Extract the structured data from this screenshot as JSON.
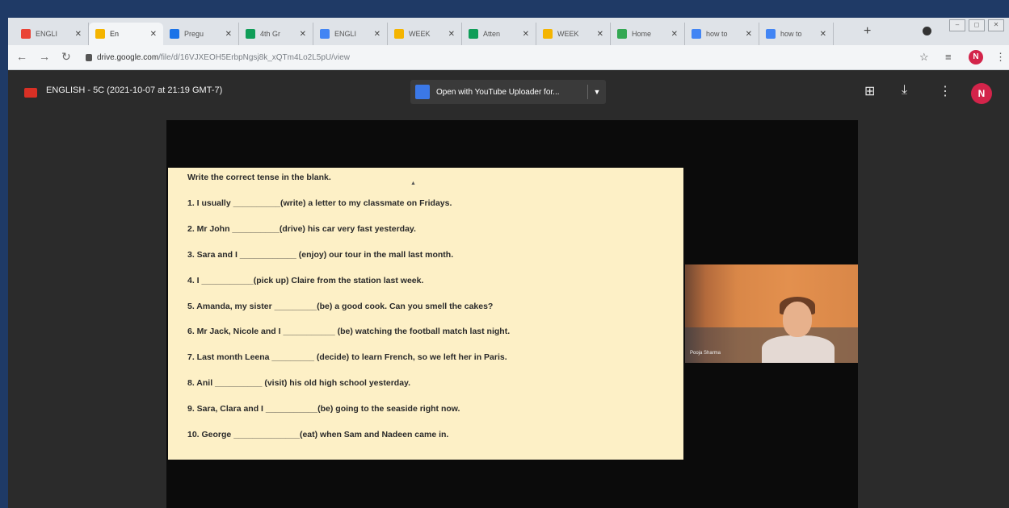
{
  "browser": {
    "tabs": [
      {
        "label": "ENGLI",
        "favicon": "gmail-icon",
        "color": "#ea4335",
        "active": false
      },
      {
        "label": "En",
        "favicon": "drive-icon",
        "color": "#f4b400",
        "active": true
      },
      {
        "label": "Pregu",
        "favicon": "forms-icon",
        "color": "#1a73e8",
        "active": false
      },
      {
        "label": "4th Gr",
        "favicon": "drive-icon",
        "color": "#0f9d58",
        "active": false
      },
      {
        "label": "ENGLI",
        "favicon": "docs-icon",
        "color": "#4285f4",
        "active": false
      },
      {
        "label": "WEEK",
        "favicon": "slides-icon",
        "color": "#f4b400",
        "active": false
      },
      {
        "label": "Atten",
        "favicon": "sheets-icon",
        "color": "#0f9d58",
        "active": false
      },
      {
        "label": "WEEK",
        "favicon": "slides-icon",
        "color": "#f4b400",
        "active": false
      },
      {
        "label": "Home",
        "favicon": "classroom-icon",
        "color": "#34a853",
        "active": false
      },
      {
        "label": "how to",
        "favicon": "google-icon",
        "color": "#4285f4",
        "active": false
      },
      {
        "label": "how to",
        "favicon": "google-icon",
        "color": "#4285f4",
        "active": false
      }
    ],
    "address": {
      "host": "drive.google.com",
      "path": "/file/d/16VJXEOH5ErbpNgsj8k_xQTm4Lo2L5pU/view"
    },
    "profile_initial": "N"
  },
  "viewer": {
    "file_title": "ENGLISH - 5C (2021-10-07 at 21:19 GMT-7)",
    "open_with_label": "Open with YouTube Uploader for...",
    "avatar_initial": "N"
  },
  "slide": {
    "instruction": "Write the correct tense in the blank.",
    "exercises": [
      "1. I usually __________(write) a letter to my classmate on Fridays.",
      "2. Mr John __________(drive) his car very fast yesterday.",
      "3. Sara and I ____________ (enjoy) our tour in the mall last month.",
      "4. I ___________(pick up) Claire from the station last week.",
      "5. Amanda, my sister _________(be) a good cook. Can you smell the cakes?",
      "6. Mr Jack, Nicole and I ___________ (be) watching the football match last night.",
      "7. Last month Leena _________ (decide) to learn French, so we left her in Paris.",
      "8. Anil __________ (visit) his old high school yesterday.",
      "9. Sara, Clara and I ___________(be) going to the seaside right now.",
      "10. George ______________(eat) when Sam and Nadeen came in."
    ]
  },
  "participant": {
    "name": "Pooja Sharma"
  },
  "colors": {
    "page_border": "#1f3a66",
    "slide_bg": "#fdf0c6",
    "avatar": "#d3244a"
  }
}
